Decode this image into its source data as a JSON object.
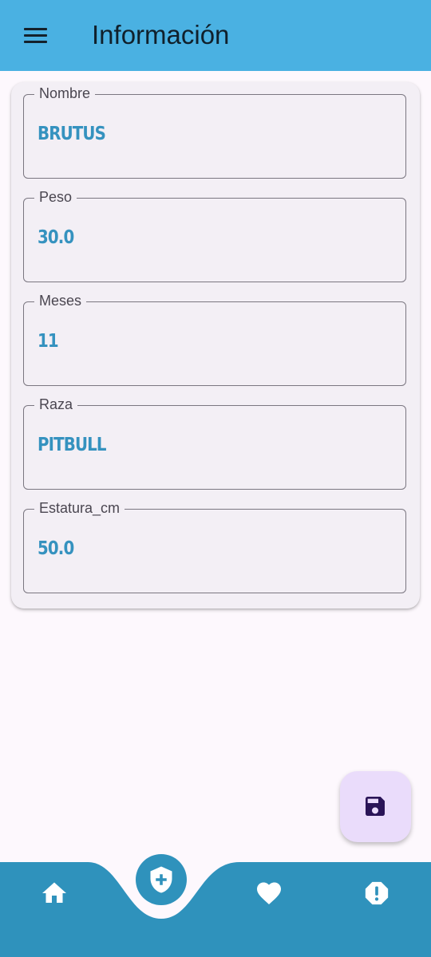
{
  "appbar": {
    "title": "Información",
    "menu_icon": "hamburger-menu-icon",
    "background": "#4ab1e2"
  },
  "form": {
    "fields": [
      {
        "label": "Nombre",
        "value": "BRUTUS"
      },
      {
        "label": "Peso",
        "value": "30.0"
      },
      {
        "label": "Meses",
        "value": "11"
      },
      {
        "label": "Raza",
        "value": "PITBULL"
      },
      {
        "label": "Estatura_cm",
        "value": "50.0"
      }
    ],
    "value_color": "#3592bf"
  },
  "fab": {
    "icon": "save-icon",
    "background": "#eadcfb"
  },
  "bottom_nav": {
    "background": "#2f92bc",
    "items": [
      {
        "icon": "home-icon"
      },
      {
        "icon": "shield-plus-icon",
        "selected": true
      },
      {
        "icon": "heart-icon"
      },
      {
        "icon": "alert-octagon-icon"
      }
    ]
  }
}
